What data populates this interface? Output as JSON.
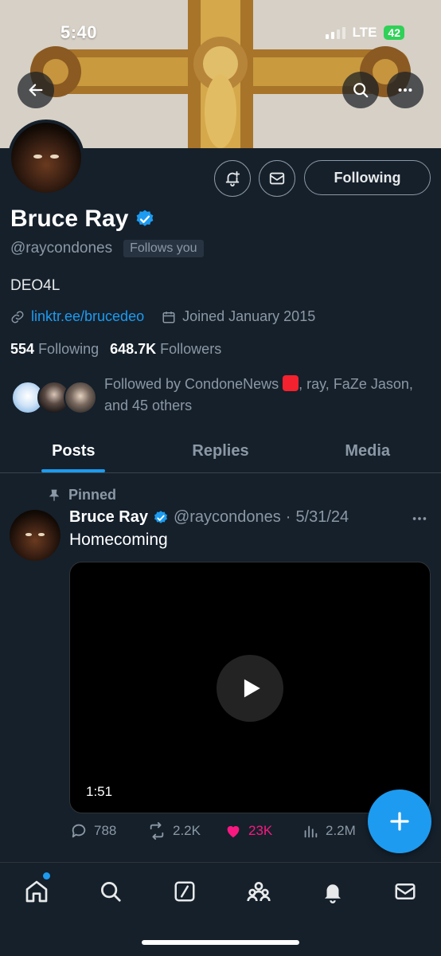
{
  "status_bar": {
    "time": "5:40",
    "network": "LTE",
    "battery": "42"
  },
  "header": {
    "back_icon": "arrow-left-icon",
    "search_icon": "search-icon",
    "more_icon": "ellipsis-icon"
  },
  "profile": {
    "name": "Bruce Ray",
    "handle": "@raycondones",
    "follows_you": "Follows you",
    "bio": "DEO4L",
    "link": "linktr.ee/brucedeo",
    "joined": "Joined January 2015",
    "following_count": "554",
    "following_label": "Following",
    "followers_count": "648.7K",
    "followers_label": "Followers",
    "followed_by_prefix": "Followed by CondoneNews",
    "followed_by_suffix": ", ray, FaZe Jason, and 45 others",
    "follow_button": "Following"
  },
  "tabs": [
    "Posts",
    "Replies",
    "Media"
  ],
  "post": {
    "pinned_label": "Pinned",
    "author_name": "Bruce Ray",
    "author_handle": "@raycondones",
    "date": "5/31/24",
    "text": "Homecoming",
    "video_duration": "1:51",
    "replies": "788",
    "reposts": "2.2K",
    "likes": "23K",
    "views": "2.2M"
  },
  "colors": {
    "accent": "#1d9bf0",
    "background": "#15202b",
    "like": "#f91880",
    "muted": "#8b98a5"
  }
}
